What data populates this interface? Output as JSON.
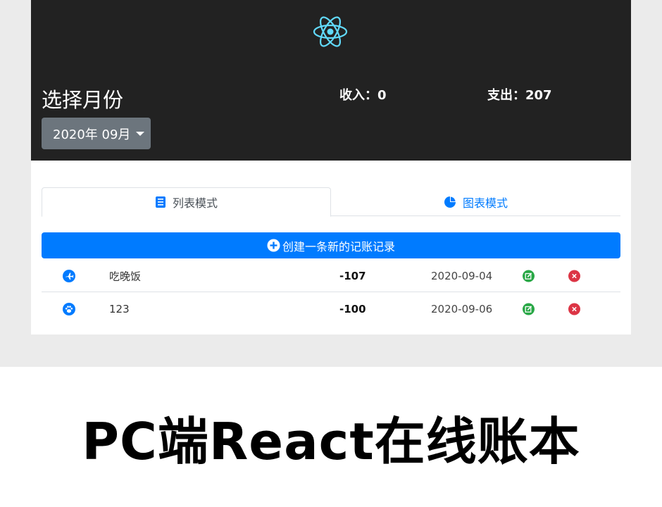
{
  "header": {
    "logo_icon": "react-logo-icon",
    "month_title": "选择月份",
    "month_selector": "2020年 09月",
    "income": {
      "label": "收入：",
      "value": "0"
    },
    "expense": {
      "label": "支出：",
      "value": "207"
    }
  },
  "tabs": [
    {
      "label": "列表模式",
      "icon": "list-icon",
      "active": true
    },
    {
      "label": "图表模式",
      "icon": "pie-chart-icon",
      "active": false
    }
  ],
  "create_button": {
    "label": "创建一条新的记账记录",
    "icon": "plus-circle-icon"
  },
  "records": [
    {
      "icon": "airplane-icon",
      "title": "吃晚饭",
      "amount": "-107",
      "date": "2020-09-04"
    },
    {
      "icon": "paw-icon",
      "title": "123",
      "amount": "-100",
      "date": "2020-09-06"
    }
  ],
  "banner": {
    "text": "PC端React在线账本"
  },
  "colors": {
    "header_bg": "#222222",
    "primary": "#007bff",
    "secondary": "#6c757d",
    "edit": "#28a745",
    "delete": "#dc3545",
    "react": "#61dafb"
  }
}
